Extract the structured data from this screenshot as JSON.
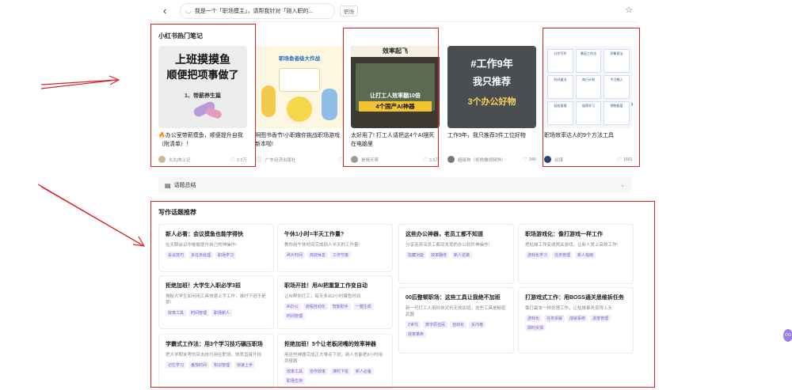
{
  "search": {
    "query": "我是一个「职场摸主」，请帮我针对「刚入职的...",
    "tag": "职场"
  },
  "hot_notes_title": "小红书热门笔记",
  "notes": [
    {
      "title": "🔥办公室带薪摸鱼，顺便提升自我（附清单）！",
      "author": "丸丸肉上记",
      "likes": "2.5万",
      "img_line1": "上班摸摸鱼",
      "img_line2": "顺便把项事做了",
      "img_line3": "1、带薪养生篇"
    },
    {
      "title": "啊图书香节!小职趣你挑战职场游戏新本啦!",
      "author": "广东经济出版社",
      "likes": "",
      "img_line1": "职场鱼者级大作战"
    },
    {
      "title": "太好用了! 打工人请把这4个AI摆死在电脑里",
      "author": "是晴天呀",
      "likes": "3.5万",
      "img_line1": "效率起飞",
      "img_line2": "让打工人效率翻10倍",
      "img_line3": "4个国产AI神器"
    },
    {
      "title": "工作9年，我只推荐3件工位好物",
      "author": "超级狗（拒绝做视频狗）",
      "likes": "348",
      "img_line1": "#工作9年",
      "img_line2": "我只推荐",
      "img_line3": "3个办公好物"
    },
    {
      "title": "职场效率达人的9个方法工具",
      "author": "出谋",
      "likes": "1681",
      "grid_labels": [
        "分步写作",
        "番茄工作法",
        "四象限法",
        "时间盒法",
        "每日计划",
        "专注输入",
        "轻松管理",
        "极简学习",
        "拥抱复盘"
      ]
    }
  ],
  "summary": {
    "label": "话题总结"
  },
  "topics_title": "写作话题推荐",
  "topics": [
    [
      {
        "title": "新人必看：会议摸鱼也能学得快",
        "desc": "在无聊会议中偷偷提升自己的神操作!",
        "tags": [
          "会议技巧",
          "多任务处理",
          "职场学习"
        ]
      },
      {
        "title": "拒绝加班！大学生入职必学3招",
        "desc": "揭秘大学生如何用工具快速上手工作，准时下班不是梦!",
        "tags": [
          "效率工具",
          "时间管理",
          "职场新人"
        ]
      },
      {
        "title": "学霸式工作法：用3个学习技巧碾压职场",
        "desc": "把大学期末考的突击技巧用在职场，效率直接开挂",
        "tags": [
          "记忆学习",
          "番茄时间",
          "知识管理",
          "快速上手"
        ]
      }
    ],
    [
      {
        "title": "午休1小时=半天工作量?",
        "desc": "教你用午休时间完成别人半天的工作量!",
        "tags": [
          "碎片时间",
          "高效休息",
          "工作节奏"
        ]
      },
      {
        "title": "职场开挂！用AI把重复工作变自动",
        "desc": "让AI帮你打工，每天多出2小时摸鱼时间",
        "tags": [
          "AI办公",
          "流程自动化",
          "智能助手",
          "一键生成",
          "时间管理"
        ]
      },
      {
        "title": "拒绝加班！5个让老板闭嘴的效率神器",
        "desc": "用这些神器完成正大堆点下班，新人也能把8小时用到极致",
        "tags": [
          "效率工具",
          "协作效率",
          "准时下班",
          "新人必备",
          "职场生存"
        ]
      }
    ],
    [
      {
        "title": "这些办公神器，老员工都不知道",
        "desc": "分享连资深员工都没发现的办公软件神操作!",
        "tags": [
          "隐藏功能",
          "效率翻倍",
          "新人逆袭"
        ]
      },
      {
        "title": "00后整顿职场：这些工具让我绝不加班",
        "desc": "新一代打工人用科技对抗无效加班，这些工具是秘密武器",
        "tags": [
          "Z世代",
          "数字原住民",
          "自动化",
          "反内卷",
          "效率革命"
        ]
      }
    ],
    [
      {
        "title": "职场游戏化：像打游戏一样工作",
        "desc": "把枯燥工作变成闯关游戏，让新人爱上高效工作!",
        "tags": [
          "游戏化学习",
          "任务管理",
          "新人指南"
        ]
      },
      {
        "title": "打游戏式工作：用BOSS通关思维拆任务",
        "desc": "像打副本一样处理工作，让枯燥事务变得上头",
        "tags": [
          "游戏化",
          "任务拆解",
          "成就系统",
          "进度管理",
          "即时反馈"
        ]
      }
    ]
  ]
}
